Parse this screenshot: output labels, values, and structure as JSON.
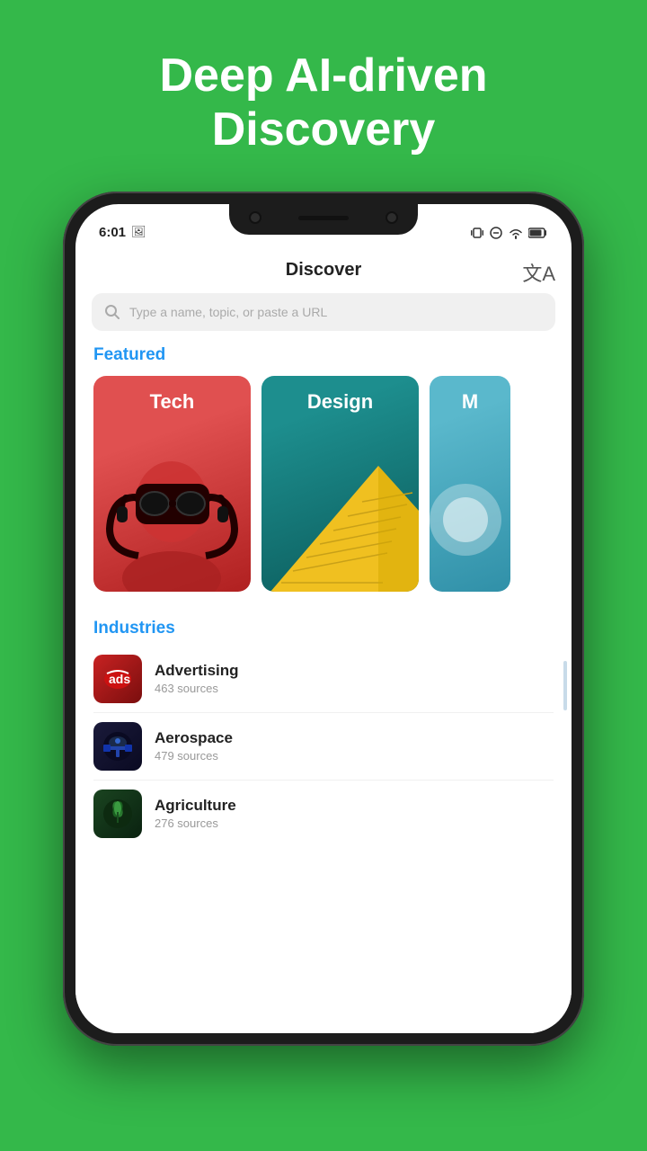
{
  "hero": {
    "title": "Deep AI-driven Discovery"
  },
  "status_bar": {
    "time": "6:01",
    "image_icon": "🖼"
  },
  "app": {
    "header_title": "Discover",
    "translate_icon": "文A",
    "search_placeholder": "Type a name, topic, or paste a URL"
  },
  "featured": {
    "label": "Featured",
    "cards": [
      {
        "label": "Tech",
        "color_start": "#e05050",
        "color_end": "#c0302a"
      },
      {
        "label": "Design",
        "color_start": "#1a8a8a",
        "color_end": "#0d6060"
      },
      {
        "label": "M",
        "color_start": "#5bbccc",
        "color_end": "#3a9aaa"
      }
    ]
  },
  "industries": {
    "label": "Industries",
    "items": [
      {
        "name": "Advertising",
        "sources": "463 sources",
        "emoji": "🔴"
      },
      {
        "name": "Aerospace",
        "sources": "479 sources",
        "emoji": "🛸"
      },
      {
        "name": "Agriculture",
        "sources": "276 sources",
        "emoji": "🌿"
      }
    ]
  }
}
